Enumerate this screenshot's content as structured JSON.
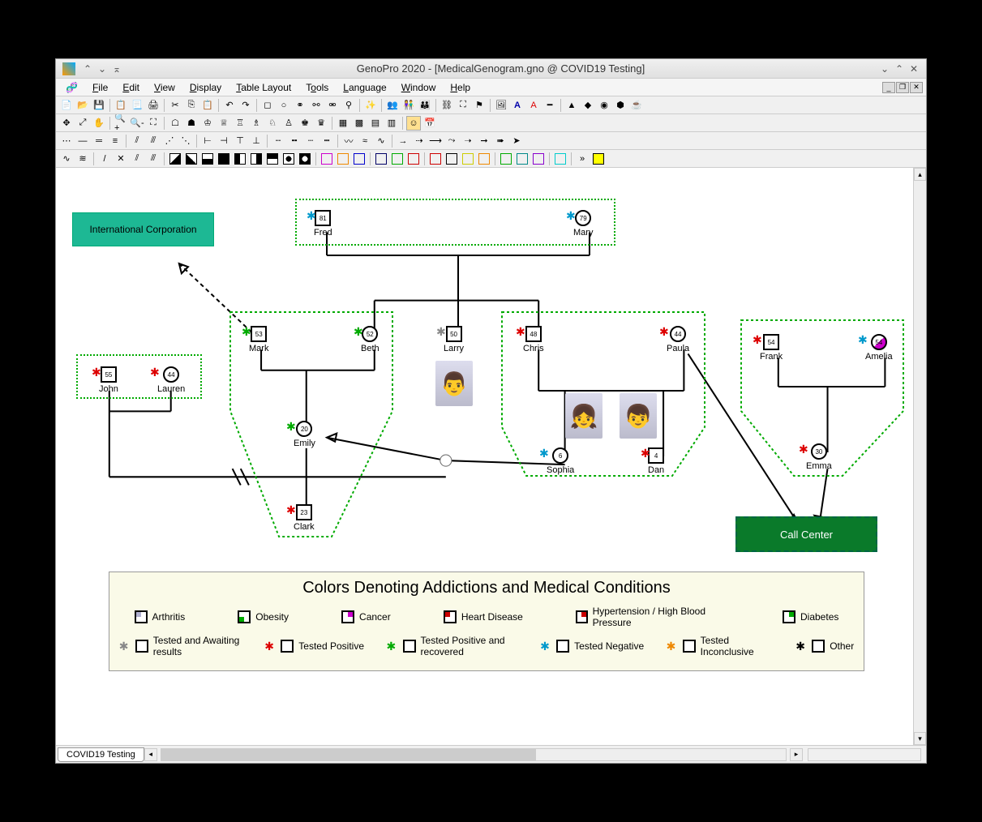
{
  "window": {
    "title": "GenoPro 2020 - [MedicalGenogram.gno @ COVID19 Testing]"
  },
  "menu": {
    "file": "File",
    "edit": "Edit",
    "view": "View",
    "display": "Display",
    "table_layout": "Table Layout",
    "tools": "Tools",
    "language": "Language",
    "window": "Window",
    "help": "Help"
  },
  "tab": {
    "name": "COVID19 Testing"
  },
  "org": {
    "corp": "International Corporation",
    "callcenter": "Call Center"
  },
  "people": {
    "fred": {
      "name": "Fred",
      "age": "81"
    },
    "mary": {
      "name": "Mary",
      "age": "79"
    },
    "mark": {
      "name": "Mark",
      "age": "53"
    },
    "beth": {
      "name": "Beth",
      "age": "52"
    },
    "larry": {
      "name": "Larry",
      "age": "50"
    },
    "chris": {
      "name": "Chris",
      "age": "48"
    },
    "paula": {
      "name": "Paula",
      "age": "44"
    },
    "frank": {
      "name": "Frank",
      "age": "54"
    },
    "amelia": {
      "name": "Amelia",
      "age": "54"
    },
    "john": {
      "name": "John",
      "age": "55"
    },
    "lauren": {
      "name": "Lauren",
      "age": "44"
    },
    "emily": {
      "name": "Emily",
      "age": "20"
    },
    "sophia": {
      "name": "Sophia",
      "age": "6"
    },
    "dan": {
      "name": "Dan",
      "age": "4"
    },
    "emma": {
      "name": "Emma",
      "age": "30"
    },
    "clark": {
      "name": "Clark",
      "age": "23"
    }
  },
  "legend": {
    "title": "Colors Denoting Addictions and Medical Conditions",
    "arthritis": "Arthritis",
    "obesity": "Obesity",
    "cancer": "Cancer",
    "heart": "Heart Disease",
    "hypertension": "Hypertension / High Blood Pressure",
    "diabetes": "Diabetes",
    "awaiting": "Tested and Awaiting results",
    "positive": "Tested Positive",
    "recovered": "Tested Positive and recovered",
    "negative": "Tested Negative",
    "inconclusive": "Tested Inconclusive",
    "other": "Other"
  },
  "colors": {
    "arthritis": "#b0b0d0",
    "obesity": "#00aa00",
    "cancer": "#cc00cc",
    "heart": "#cc0000",
    "hypertension": "#cc0000",
    "diabetes": "#00aa00",
    "cluster": "#00aa00",
    "org": "#1db894",
    "callcenter": "#0a7a2a"
  }
}
